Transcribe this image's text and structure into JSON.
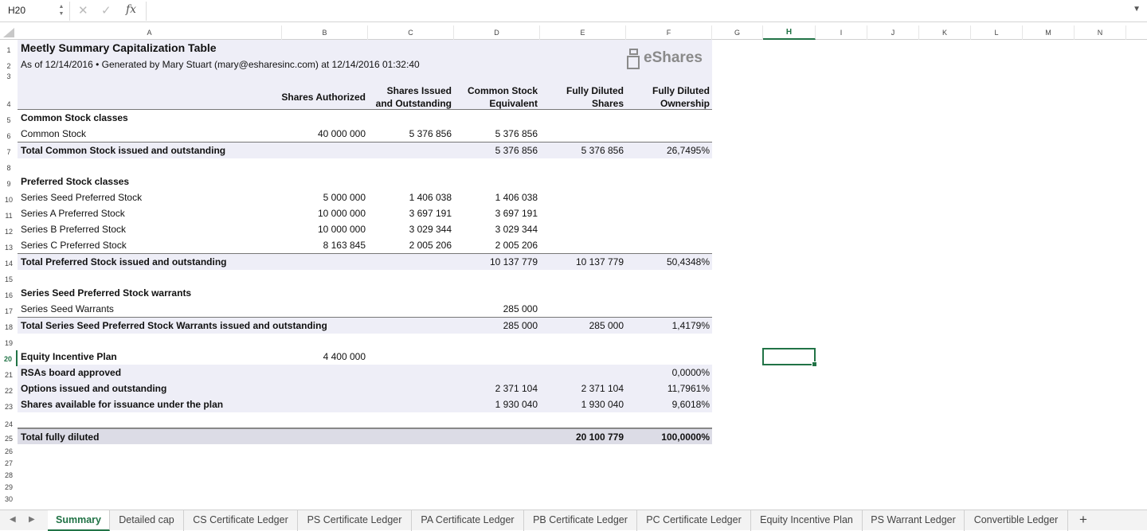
{
  "formula_bar": {
    "cell_ref": "H20",
    "cancel_icon": "✕",
    "confirm_icon": "✓",
    "fx_label": "fx",
    "formula": ""
  },
  "columns": [
    "A",
    "B",
    "C",
    "D",
    "E",
    "F",
    "G",
    "H",
    "I",
    "J",
    "K",
    "L",
    "M",
    "N"
  ],
  "active_column": "H",
  "rows": [
    "1",
    "2",
    "3",
    "4",
    "5",
    "6",
    "7",
    "8",
    "9",
    "10",
    "11",
    "12",
    "13",
    "14",
    "15",
    "16",
    "17",
    "18",
    "19",
    "20",
    "21",
    "22",
    "23",
    "24",
    "25",
    "26",
    "27",
    "28",
    "29",
    "30"
  ],
  "active_row": "20",
  "sheet": {
    "title": "Meetly Summary Capitalization Table",
    "subtitle": "As of 12/14/2016 • Generated by Mary Stuart (mary@esharesinc.com) at 12/14/2016 01:32:40",
    "logo_text": "eShares",
    "headers": {
      "authorized": "Shares Authorized",
      "issued_l1": "Shares Issued",
      "issued_l2": "and Outstanding",
      "cse_l1": "Common Stock",
      "cse_l2": "Equivalent",
      "fds_l1": "Fully Diluted",
      "fds_l2": "Shares",
      "fdo_l1": "Fully Diluted",
      "fdo_l2": "Ownership"
    },
    "r5": {
      "label": "Common Stock classes"
    },
    "r6": {
      "label": "Common Stock",
      "authorized": "40 000 000",
      "issued": "5 376 856",
      "cse": "5 376 856"
    },
    "r7": {
      "label": "Total Common Stock issued and outstanding",
      "cse": "5 376 856",
      "fds": "5 376 856",
      "fdo": "26,7495%"
    },
    "r9": {
      "label": "Preferred Stock classes"
    },
    "r10": {
      "label": "Series Seed Preferred Stock",
      "authorized": "5 000 000",
      "issued": "1 406 038",
      "cse": "1 406 038"
    },
    "r11": {
      "label": "Series A Preferred Stock",
      "authorized": "10 000 000",
      "issued": "3 697 191",
      "cse": "3 697 191"
    },
    "r12": {
      "label": "Series B Preferred Stock",
      "authorized": "10 000 000",
      "issued": "3 029 344",
      "cse": "3 029 344"
    },
    "r13": {
      "label": "Series C Preferred Stock",
      "authorized": "8 163 845",
      "issued": "2 005 206",
      "cse": "2 005 206"
    },
    "r14": {
      "label": "Total Preferred Stock issued and outstanding",
      "cse": "10 137 779",
      "fds": "10 137 779",
      "fdo": "50,4348%"
    },
    "r16": {
      "label": "Series Seed Preferred Stock warrants"
    },
    "r17": {
      "label": "Series Seed Warrants",
      "cse": "285 000"
    },
    "r18": {
      "label": "Total Series Seed Preferred Stock Warrants issued and outstanding",
      "cse": "285 000",
      "fds": "285 000",
      "fdo": "1,4179%"
    },
    "r20": {
      "label": "Equity Incentive Plan",
      "authorized": "4 400 000"
    },
    "r21": {
      "label": "RSAs board approved",
      "fdo": "0,0000%"
    },
    "r22": {
      "label": "Options issued and outstanding",
      "cse": "2 371 104",
      "fds": "2 371 104",
      "fdo": "11,7961%"
    },
    "r23": {
      "label": "Shares available for issuance under the plan",
      "cse": "1 930 040",
      "fds": "1 930 040",
      "fdo": "9,6018%"
    },
    "r25": {
      "label": "Total fully diluted",
      "fds": "20 100 779",
      "fdo": "100,0000%"
    }
  },
  "tabs": [
    {
      "label": "Summary",
      "active": true
    },
    {
      "label": "Detailed cap"
    },
    {
      "label": "CS Certificate Ledger"
    },
    {
      "label": "PS Certificate Ledger"
    },
    {
      "label": "PA Certificate Ledger"
    },
    {
      "label": "PB Certificate Ledger"
    },
    {
      "label": "PC Certificate Ledger"
    },
    {
      "label": "Equity Incentive Plan"
    },
    {
      "label": "PS Warrant Ledger"
    },
    {
      "label": "Convertible Ledger"
    }
  ],
  "add_tab_label": "+",
  "nav": {
    "prev": "◀",
    "next": "▶"
  },
  "colors": {
    "accent": "#217346",
    "band": "#eeeef7"
  }
}
